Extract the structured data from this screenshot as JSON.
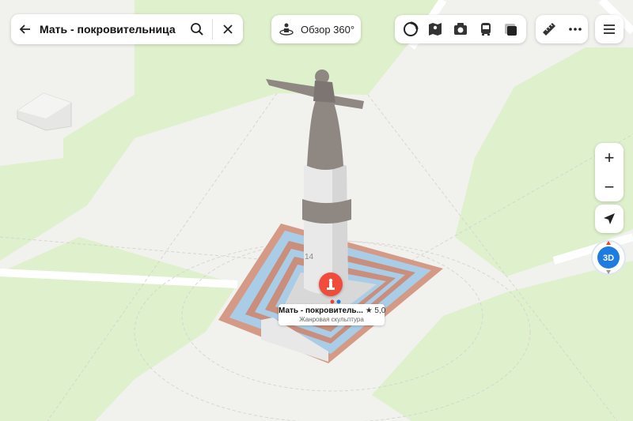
{
  "search": {
    "query": "Мать - покровительница",
    "back_icon": "arrow-left-icon",
    "search_icon": "search-icon",
    "clear_icon": "close-icon"
  },
  "toolbar": {
    "panorama_label": "Обзор 360°",
    "layers": [
      "traffic-icon",
      "map-layers-icon",
      "panorama-camera-icon",
      "transit-icon",
      "dark-mode-icon"
    ],
    "ruler_icon": "ruler-icon",
    "more_icon": "more-icon",
    "menu_icon": "menu-icon"
  },
  "controls": {
    "zoom_in": "+",
    "zoom_out": "−",
    "locate_icon": "navigation-arrow-icon",
    "mode_3d": "3D"
  },
  "map": {
    "building_number": "14"
  },
  "place": {
    "name": "Мать - покровитель...",
    "rating": "★ 5,0",
    "category": "Жанровая скульптура"
  },
  "colors": {
    "park": "#dff0cc",
    "ground": "#f1f1ee",
    "pin": "#f14b3b",
    "accent": "#1e7be0"
  }
}
